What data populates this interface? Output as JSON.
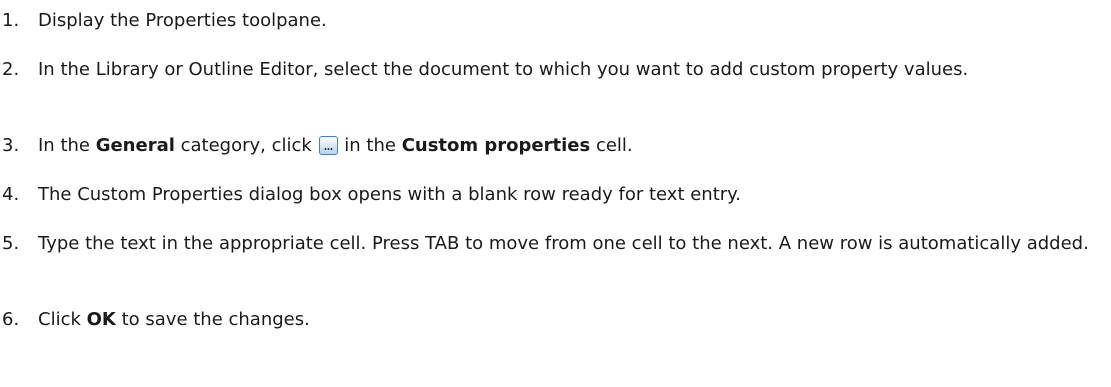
{
  "steps": [
    {
      "num": "1.",
      "text": "Display the Properties toolpane."
    },
    {
      "num": "2.",
      "text": "In the Library or Outline Editor, select the document to which you want to add custom property values."
    },
    {
      "num": "3.",
      "pre": "In the ",
      "bold1": "General",
      "mid": " category, click ",
      "icon": "ellipsis-button-icon",
      "post1": " in the ",
      "bold2": "Custom properties",
      "post2": " cell."
    },
    {
      "num": "4.",
      "text": "The Custom Properties dialog box opens with a blank row ready for text entry."
    },
    {
      "num": "5.",
      "text": "Type the text in the appropriate cell. Press TAB to move from one cell to the next. A new row is automatically added."
    },
    {
      "num": "6.",
      "pre": "Click ",
      "bold": "OK",
      "post": " to save the changes."
    }
  ]
}
